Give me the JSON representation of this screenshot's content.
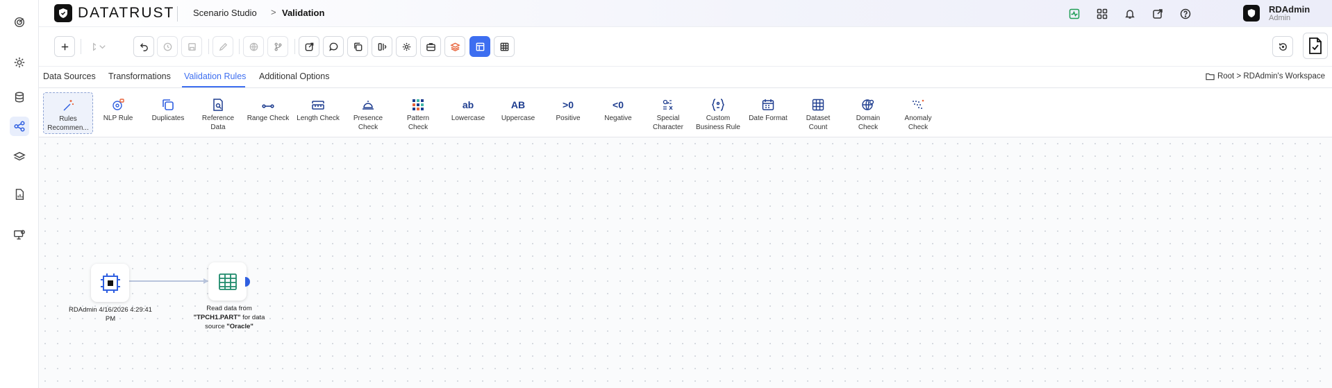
{
  "app": {
    "brand_a": "DATA",
    "brand_b": "TRUST",
    "breadcrumb": [
      "Scenario Studio",
      "Validation"
    ],
    "breadcrumb_sep": ">"
  },
  "user": {
    "name": "RDAdmin",
    "role": "Admin"
  },
  "tabs": [
    {
      "label": "Data Sources"
    },
    {
      "label": "Transformations"
    },
    {
      "label": "Validation Rules",
      "active": true
    },
    {
      "label": "Additional Options"
    }
  ],
  "workspace_path": "Root > RDAdmin's Workspace",
  "rules": [
    {
      "line1": "Rules",
      "line2": "Recommen...",
      "icon": "magic-wand-icon"
    },
    {
      "line1": "NLP Rule",
      "line2": "",
      "icon": "nlp-icon"
    },
    {
      "line1": "Duplicates",
      "line2": "",
      "icon": "duplicates-icon"
    },
    {
      "line1": "Reference",
      "line2": "Data",
      "icon": "reference-data-icon"
    },
    {
      "line1": "Range Check",
      "line2": "",
      "icon": "range-icon"
    },
    {
      "line1": "Length Check",
      "line2": "",
      "icon": "ruler-icon"
    },
    {
      "line1": "Presence",
      "line2": "Check",
      "icon": "bell-icon"
    },
    {
      "line1": "Pattern",
      "line2": "Check",
      "icon": "pattern-icon"
    },
    {
      "line1": "Lowercase",
      "line2": "",
      "icon": "lowercase-icon",
      "glyph": "ab"
    },
    {
      "line1": "Uppercase",
      "line2": "",
      "icon": "uppercase-icon",
      "glyph": "AB"
    },
    {
      "line1": "Positive",
      "line2": "",
      "icon": "positive-icon",
      "glyph": ">0"
    },
    {
      "line1": "Negative",
      "line2": "",
      "icon": "negative-icon",
      "glyph": "<0"
    },
    {
      "line1": "Special",
      "line2": "Character",
      "icon": "special-character-icon"
    },
    {
      "line1": "Custom",
      "line2": "Business Rule",
      "icon": "custom-rule-icon"
    },
    {
      "line1": "Date Format",
      "line2": "",
      "icon": "calendar-icon"
    },
    {
      "line1": "Dataset",
      "line2": "Count",
      "icon": "grid-count-icon"
    },
    {
      "line1": "Domain",
      "line2": "Check",
      "icon": "domain-icon"
    },
    {
      "line1": "Anomaly",
      "line2": "Check",
      "icon": "anomaly-icon"
    }
  ],
  "nodes": {
    "start_label": "RDAdmin 4/16/2026 4:29:41 PM",
    "read_label_1": "Read data from ",
    "read_table": "\"TPCH1.PART\"",
    "read_label_2": " for data source ",
    "read_source": "\"Oracle\""
  },
  "colors": {
    "accent": "#3d6ef0",
    "brand": "#111111",
    "node_green": "#1f8a6b"
  }
}
